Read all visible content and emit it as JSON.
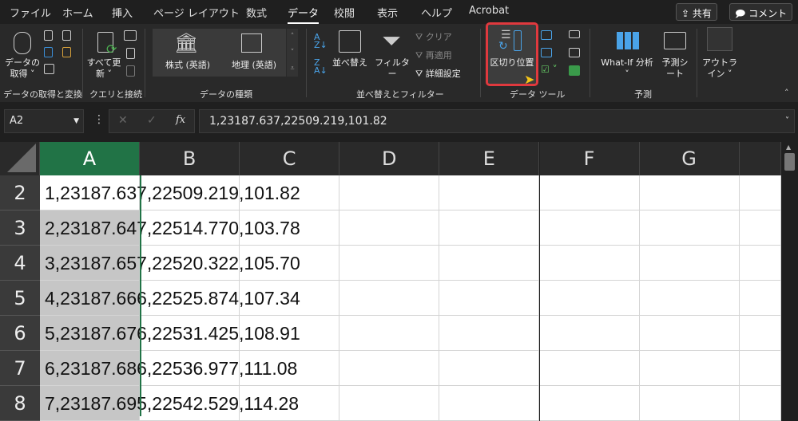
{
  "tabs": [
    "ファイル",
    "ホーム",
    "挿入",
    "ページ レイアウト",
    "数式",
    "データ",
    "校閲",
    "表示",
    "ヘルプ",
    "Acrobat"
  ],
  "active_tab": "データ",
  "share_label": "共有",
  "comment_label": "コメント",
  "groups": {
    "get_transform": {
      "label": "データの取得と変換",
      "get_data": "データの取得 ˅"
    },
    "queries": {
      "label": "クエリと接続",
      "refresh_all": "すべて更新 ˅"
    },
    "data_types": {
      "label": "データの種類",
      "stocks": "株式 (英語)",
      "geography": "地理 (英語)"
    },
    "sort_filter": {
      "label": "並べ替えとフィルター",
      "sort": "並べ替え",
      "filter": "フィルター",
      "clear": "クリア",
      "reapply": "再適用",
      "advanced": "詳細設定"
    },
    "data_tools": {
      "label": "データ ツール",
      "text_to_columns": "区切り位置"
    },
    "forecast": {
      "label": "予測",
      "what_if": "What-If 分析",
      "what_if_arrow": "˅",
      "forecast_sheet": "予測シート"
    },
    "outline": {
      "label": "アウトライン ˅"
    }
  },
  "name_box": "A2",
  "formula": "1,23187.637,22509.219,101.82",
  "columns": [
    "A",
    "B",
    "C",
    "D",
    "E",
    "F",
    "G"
  ],
  "rows": [
    {
      "num": "2",
      "text": "1,23187.637,22509.219,101.82"
    },
    {
      "num": "3",
      "text": "2,23187.647,22514.770,103.78"
    },
    {
      "num": "4",
      "text": "3,23187.657,22520.322,105.70"
    },
    {
      "num": "5",
      "text": "4,23187.666,22525.874,107.34"
    },
    {
      "num": "6",
      "text": "5,23187.676,22531.425,108.91"
    },
    {
      "num": "7",
      "text": "6,23187.686,22536.977,111.08"
    },
    {
      "num": "8",
      "text": "7,23187.695,22542.529,114.28"
    }
  ],
  "colors": {
    "accent": "#217346",
    "highlight": "#e0393e"
  }
}
